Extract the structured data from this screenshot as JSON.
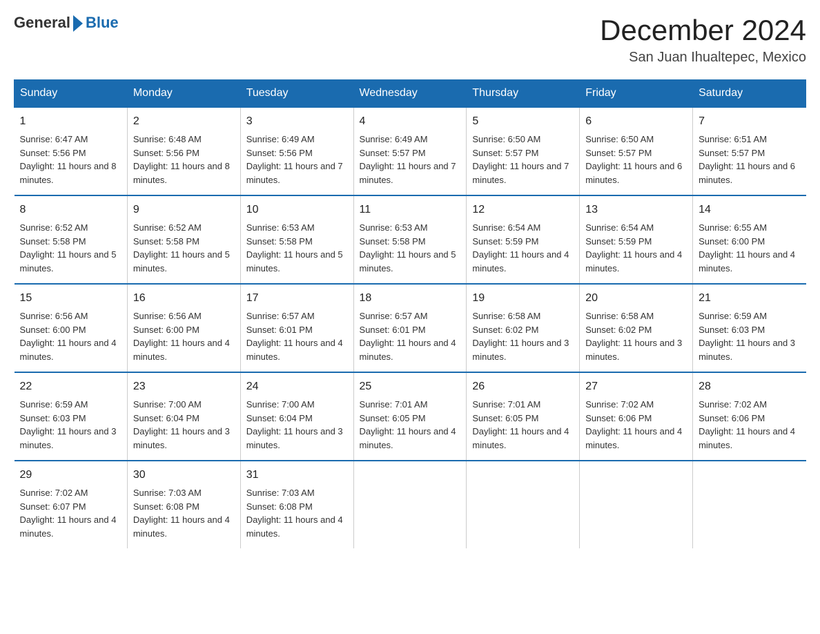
{
  "logo": {
    "text_general": "General",
    "text_blue": "Blue"
  },
  "header": {
    "title": "December 2024",
    "subtitle": "San Juan Ihualtepec, Mexico"
  },
  "weekdays": [
    "Sunday",
    "Monday",
    "Tuesday",
    "Wednesday",
    "Thursday",
    "Friday",
    "Saturday"
  ],
  "weeks": [
    [
      {
        "day": "1",
        "sunrise": "6:47 AM",
        "sunset": "5:56 PM",
        "daylight": "11 hours and 8 minutes."
      },
      {
        "day": "2",
        "sunrise": "6:48 AM",
        "sunset": "5:56 PM",
        "daylight": "11 hours and 8 minutes."
      },
      {
        "day": "3",
        "sunrise": "6:49 AM",
        "sunset": "5:56 PM",
        "daylight": "11 hours and 7 minutes."
      },
      {
        "day": "4",
        "sunrise": "6:49 AM",
        "sunset": "5:57 PM",
        "daylight": "11 hours and 7 minutes."
      },
      {
        "day": "5",
        "sunrise": "6:50 AM",
        "sunset": "5:57 PM",
        "daylight": "11 hours and 7 minutes."
      },
      {
        "day": "6",
        "sunrise": "6:50 AM",
        "sunset": "5:57 PM",
        "daylight": "11 hours and 6 minutes."
      },
      {
        "day": "7",
        "sunrise": "6:51 AM",
        "sunset": "5:57 PM",
        "daylight": "11 hours and 6 minutes."
      }
    ],
    [
      {
        "day": "8",
        "sunrise": "6:52 AM",
        "sunset": "5:58 PM",
        "daylight": "11 hours and 5 minutes."
      },
      {
        "day": "9",
        "sunrise": "6:52 AM",
        "sunset": "5:58 PM",
        "daylight": "11 hours and 5 minutes."
      },
      {
        "day": "10",
        "sunrise": "6:53 AM",
        "sunset": "5:58 PM",
        "daylight": "11 hours and 5 minutes."
      },
      {
        "day": "11",
        "sunrise": "6:53 AM",
        "sunset": "5:58 PM",
        "daylight": "11 hours and 5 minutes."
      },
      {
        "day": "12",
        "sunrise": "6:54 AM",
        "sunset": "5:59 PM",
        "daylight": "11 hours and 4 minutes."
      },
      {
        "day": "13",
        "sunrise": "6:54 AM",
        "sunset": "5:59 PM",
        "daylight": "11 hours and 4 minutes."
      },
      {
        "day": "14",
        "sunrise": "6:55 AM",
        "sunset": "6:00 PM",
        "daylight": "11 hours and 4 minutes."
      }
    ],
    [
      {
        "day": "15",
        "sunrise": "6:56 AM",
        "sunset": "6:00 PM",
        "daylight": "11 hours and 4 minutes."
      },
      {
        "day": "16",
        "sunrise": "6:56 AM",
        "sunset": "6:00 PM",
        "daylight": "11 hours and 4 minutes."
      },
      {
        "day": "17",
        "sunrise": "6:57 AM",
        "sunset": "6:01 PM",
        "daylight": "11 hours and 4 minutes."
      },
      {
        "day": "18",
        "sunrise": "6:57 AM",
        "sunset": "6:01 PM",
        "daylight": "11 hours and 4 minutes."
      },
      {
        "day": "19",
        "sunrise": "6:58 AM",
        "sunset": "6:02 PM",
        "daylight": "11 hours and 3 minutes."
      },
      {
        "day": "20",
        "sunrise": "6:58 AM",
        "sunset": "6:02 PM",
        "daylight": "11 hours and 3 minutes."
      },
      {
        "day": "21",
        "sunrise": "6:59 AM",
        "sunset": "6:03 PM",
        "daylight": "11 hours and 3 minutes."
      }
    ],
    [
      {
        "day": "22",
        "sunrise": "6:59 AM",
        "sunset": "6:03 PM",
        "daylight": "11 hours and 3 minutes."
      },
      {
        "day": "23",
        "sunrise": "7:00 AM",
        "sunset": "6:04 PM",
        "daylight": "11 hours and 3 minutes."
      },
      {
        "day": "24",
        "sunrise": "7:00 AM",
        "sunset": "6:04 PM",
        "daylight": "11 hours and 3 minutes."
      },
      {
        "day": "25",
        "sunrise": "7:01 AM",
        "sunset": "6:05 PM",
        "daylight": "11 hours and 4 minutes."
      },
      {
        "day": "26",
        "sunrise": "7:01 AM",
        "sunset": "6:05 PM",
        "daylight": "11 hours and 4 minutes."
      },
      {
        "day": "27",
        "sunrise": "7:02 AM",
        "sunset": "6:06 PM",
        "daylight": "11 hours and 4 minutes."
      },
      {
        "day": "28",
        "sunrise": "7:02 AM",
        "sunset": "6:06 PM",
        "daylight": "11 hours and 4 minutes."
      }
    ],
    [
      {
        "day": "29",
        "sunrise": "7:02 AM",
        "sunset": "6:07 PM",
        "daylight": "11 hours and 4 minutes."
      },
      {
        "day": "30",
        "sunrise": "7:03 AM",
        "sunset": "6:08 PM",
        "daylight": "11 hours and 4 minutes."
      },
      {
        "day": "31",
        "sunrise": "7:03 AM",
        "sunset": "6:08 PM",
        "daylight": "11 hours and 4 minutes."
      },
      {
        "day": "",
        "sunrise": "",
        "sunset": "",
        "daylight": ""
      },
      {
        "day": "",
        "sunrise": "",
        "sunset": "",
        "daylight": ""
      },
      {
        "day": "",
        "sunrise": "",
        "sunset": "",
        "daylight": ""
      },
      {
        "day": "",
        "sunrise": "",
        "sunset": "",
        "daylight": ""
      }
    ]
  ],
  "labels": {
    "sunrise": "Sunrise: ",
    "sunset": "Sunset: ",
    "daylight": "Daylight: "
  }
}
